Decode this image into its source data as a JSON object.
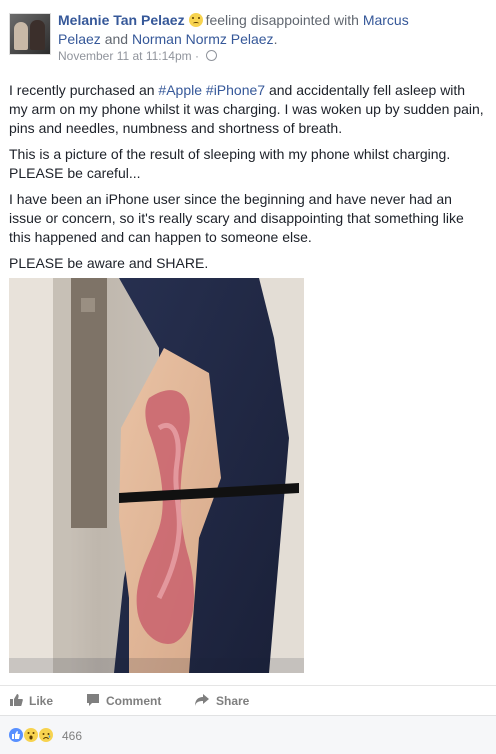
{
  "post": {
    "author": "Melanie Tan Pelaez",
    "feeling_prefix": "feeling disappointed with",
    "tagged_1": "Marcus",
    "tagged_1b": "Pelaez",
    "and_text": "and",
    "tagged_2": "Norman Normz Pelaez",
    "period": ".",
    "timestamp": "November 11 at 11:14pm",
    "dot": "·",
    "paragraph_1_a": "I recently purchased an",
    "hashtag_1": "#Apple",
    "hashtag_2": "#iPhone7",
    "paragraph_1_b": "and accidentally fell asleep with my arm on my phone whilst it was charging. I was woken up by sudden pain, pins and needles, numbness and shortness of breath.",
    "paragraph_2": "This is a picture of the result of sleeping with my phone whilst charging. PLEASE be careful...",
    "paragraph_3": "I have been an iPhone user since the beginning and have never had an issue or concern, so it's really scary and disappointing that something like this happened and can happen to someone else.",
    "paragraph_4": "PLEASE be aware and SHARE."
  },
  "actions": {
    "like": "Like",
    "comment": "Comment",
    "share": "Share"
  },
  "reactions": {
    "count": "466",
    "types": [
      "like-icon",
      "wow-icon",
      "sad-icon"
    ]
  },
  "icons": {
    "feeling": "disappointed-emoji-icon",
    "privacy": "globe-icon"
  }
}
